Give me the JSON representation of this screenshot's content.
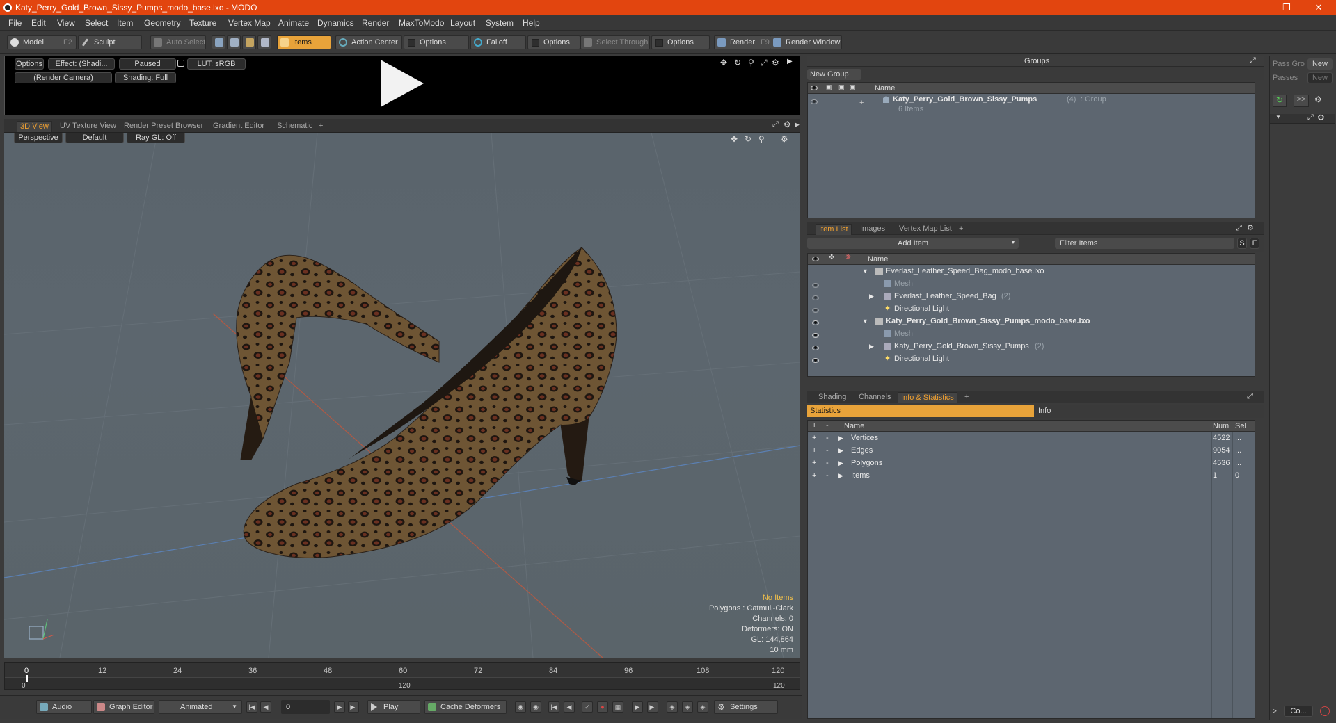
{
  "window": {
    "title": "Katy_Perry_Gold_Brown_Sissy_Pumps_modo_base.lxo - MODO"
  },
  "menu": [
    "File",
    "Edit",
    "View",
    "Select",
    "Item",
    "Geometry",
    "Texture",
    "Vertex Map",
    "Animate",
    "Dynamics",
    "Render",
    "MaxToModo",
    "Layout",
    "System",
    "Help"
  ],
  "toolbar": {
    "model": "Model",
    "model_key": "F2",
    "sculpt": "Sculpt",
    "auto_select": "Auto Select",
    "items": "Items",
    "action_center": "Action Center",
    "options1": "Options",
    "falloff": "Falloff",
    "options2": "Options",
    "select_through": "Select Through",
    "options3": "Options",
    "render": "Render",
    "render_key": "F9",
    "render_window": "Render Window"
  },
  "preview": {
    "options": "Options",
    "effect": "Effect: (Shadi...",
    "paused": "Paused",
    "lut": "LUT: sRGB",
    "camera": "(Render Camera)",
    "shading": "Shading: Full"
  },
  "viewport_tabs": [
    "3D View",
    "UV Texture View",
    "Render Preset Browser",
    "Gradient Editor",
    "Schematic",
    "+"
  ],
  "viewport": {
    "perspective": "Perspective",
    "default": "Default",
    "raygl": "Ray GL: Off",
    "hud": {
      "no_items": "No Items",
      "polygons": "Polygons : Catmull-Clark",
      "channels": "Channels: 0",
      "deformers": "Deformers: ON",
      "gl": "GL: 144,864",
      "scale": "10 mm"
    }
  },
  "timeline": {
    "ticks": [
      "0",
      "12",
      "24",
      "36",
      "48",
      "60",
      "72",
      "84",
      "96",
      "108",
      "120"
    ],
    "sub_left": "0",
    "sub_mid": "120",
    "sub_right": "120"
  },
  "bottombar": {
    "audio": "Audio",
    "graph_editor": "Graph Editor",
    "animated": "Animated",
    "frame": "0",
    "play": "Play",
    "cache": "Cache Deformers",
    "settings": "Settings"
  },
  "groups": {
    "title": "Groups",
    "new_group": "New Group",
    "col_name": "Name",
    "row_name": "Katy_Perry_Gold_Brown_Sissy_Pumps",
    "row_count": "(4)",
    "row_type": ": Group",
    "row_sub": "6 Items"
  },
  "side": {
    "pass_group": "Pass Gro",
    "new1": "New",
    "passes": "Passes",
    "new2": "New",
    "arrows": ">>",
    "co": "Co..."
  },
  "itemlist": {
    "tabs": [
      "Item List",
      "Images",
      "Vertex Map List",
      "+"
    ],
    "add_item": "Add Item",
    "filter": "Filter Items",
    "s": "S",
    "f": "F",
    "col_name": "Name",
    "rows": [
      {
        "label": "Everlast_Leather_Speed_Bag_modo_base.lxo",
        "bold": false
      },
      {
        "label": "Mesh",
        "bold": false
      },
      {
        "label": "Everlast_Leather_Speed_Bag",
        "count": "(2)"
      },
      {
        "label": "Directional Light"
      },
      {
        "label": "Katy_Perry_Gold_Brown_Sissy_Pumps_modo_base.lxo",
        "bold": true
      },
      {
        "label": "Mesh"
      },
      {
        "label": "Katy_Perry_Gold_Brown_Sissy_Pumps",
        "count": "(2)"
      },
      {
        "label": "Directional Light"
      }
    ]
  },
  "stats": {
    "tabs": [
      "Shading",
      "Channels",
      "Info & Statistics",
      "+"
    ],
    "statistics": "Statistics",
    "info": "Info",
    "col_name": "Name",
    "col_num": "Num",
    "col_sel": "Sel",
    "rows": [
      {
        "name": "Vertices",
        "num": "4522",
        "sel": "..."
      },
      {
        "name": "Edges",
        "num": "9054",
        "sel": "..."
      },
      {
        "name": "Polygons",
        "num": "4536",
        "sel": "..."
      },
      {
        "name": "Items",
        "num": "1",
        "sel": "0"
      }
    ]
  },
  "colors": {
    "titlebar": "#e2450f",
    "accent": "#e8a33a",
    "panel": "#5d6670",
    "viewport": "#5a646c"
  }
}
